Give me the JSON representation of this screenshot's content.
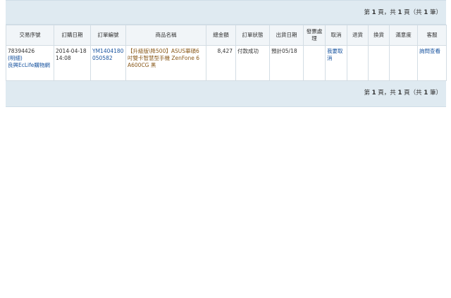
{
  "pager": {
    "page_label": "第",
    "current": "1",
    "page_unit": "頁，共",
    "total": "1",
    "total_unit": "頁（共",
    "count": "1",
    "count_unit": "筆）"
  },
  "table": {
    "headers": [
      "交易序號",
      "訂購日期",
      "訂單編號",
      "商品名稱",
      "總金額",
      "訂單狀態",
      "出貨日期",
      "發票處理",
      "取消",
      "退貨",
      "換貨",
      "滿意度",
      "客服"
    ],
    "row": {
      "serial": "78394426",
      "serial_note": "(明細)",
      "store": "良興EcLife購物網",
      "date": "2014-04-18",
      "time": "14:08",
      "order_no": "YM1404180050582",
      "product": "【升級版\\降500】ASUS華碩6吋雙卡智慧型手機 ZenFone 6 A600CG 黑",
      "total": "8,427",
      "status": "付款成功",
      "ship_date": "預計05/18",
      "invoice": "",
      "cancel": "我要取消",
      "return": "",
      "exchange": "",
      "satisfaction": "",
      "service": "詢問查看"
    }
  },
  "colors": {
    "bar": "#dfeaf1",
    "link": "#1a55a0",
    "border": "#d3dde4"
  }
}
